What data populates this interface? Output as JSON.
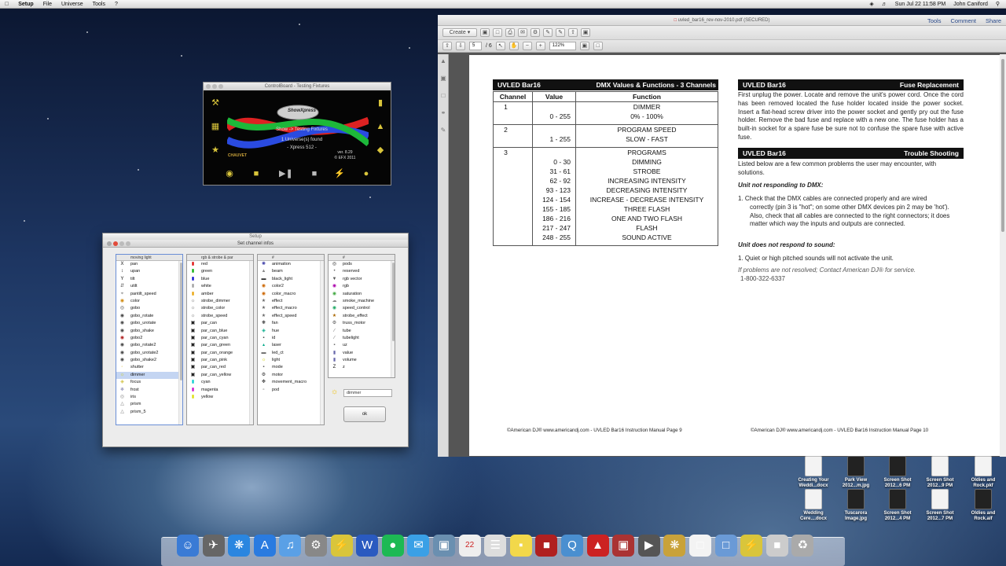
{
  "menubar": {
    "apple": "",
    "items": [
      "Setup",
      "File",
      "Universe",
      "Tools",
      "?"
    ],
    "clock": "Sun Jul 22  11:58 PM",
    "user": "John Caniford"
  },
  "controlboard": {
    "title": "ControlBoard - Testing Fixtures",
    "brand": "ShowXpress",
    "line1": "Show -> Testing Fixtures",
    "line2": "1 Universe(s) found",
    "line3": "- Xpress 512 -",
    "version": "ver. 8.29",
    "copyright": "© EFX 2011",
    "chauvet": "CHAUVET"
  },
  "setup": {
    "title": "Setup",
    "dialog_title": "Set channel infos",
    "col1_header": "moving light",
    "col2_header": "rgb & strobe & par",
    "col3_header": "#",
    "col4_header": "#",
    "col1": [
      "pan",
      "upan",
      "tilt",
      "utilt",
      "pantilt_speed",
      "color",
      "gobo",
      "gobo_rotate",
      "gobo_urotate",
      "gobo_shake",
      "gobo2",
      "gobo_rotate2",
      "gobo_urotate2",
      "gobo_shake2",
      "shutter",
      "dimmer",
      "focus",
      "frost",
      "iris",
      "prism",
      "prism_5"
    ],
    "col2": [
      "red",
      "green",
      "blue",
      "white",
      "amber",
      "strobe_dimmer",
      "strobe_color",
      "strobe_speed",
      "par_can",
      "par_can_blue",
      "par_can_cyan",
      "par_can_green",
      "par_can_orange",
      "par_can_pink",
      "par_can_red",
      "par_can_yellow",
      "cyan",
      "magenta",
      "yellow"
    ],
    "col3": [
      "animation",
      "beam",
      "black_light",
      "color2",
      "color_macro",
      "effect",
      "effect_macro",
      "effect_speed",
      "fan",
      "hue",
      "id",
      "laser",
      "led_ct",
      "light",
      "mode",
      "motor",
      "movement_macro",
      "pod"
    ],
    "col4": [
      "pods",
      "reserved",
      "rgb vector",
      "rgb",
      "saturation",
      "smoke_machine",
      "speed_control",
      "strobe_effect",
      "truss_motor",
      "tube",
      "tubelight",
      "uz",
      "value",
      "volume",
      "z"
    ],
    "selected": "dimmer",
    "field_value": "dimmer",
    "ok": "ok"
  },
  "pdf": {
    "title": "uvled_bar16_rev-nov-2010.pdf (SECURED)",
    "create": "Create",
    "page_current": "5",
    "page_total": "/ 6",
    "zoom": "122%",
    "links": [
      "Tools",
      "Comment",
      "Share"
    ],
    "left": {
      "bar_left": "UVLED Bar16",
      "bar_right": "DMX Values & Functions - 3 Channels",
      "th": [
        "Channel",
        "Value",
        "Function"
      ],
      "groups": [
        {
          "channel": "1",
          "values": [
            "",
            "0 - 255"
          ],
          "functions": [
            "DIMMER",
            "0% - 100%"
          ]
        },
        {
          "channel": "2",
          "values": [
            "",
            "1 - 255"
          ],
          "functions": [
            "PROGRAM SPEED",
            "SLOW - FAST"
          ]
        },
        {
          "channel": "3",
          "values": [
            "",
            "0 - 30",
            "31 - 61",
            "62 - 92",
            "93 - 123",
            "124 - 154",
            "155 - 185",
            "186 - 216",
            "217 - 247",
            "248 - 255"
          ],
          "functions": [
            "PROGRAMS",
            "DIMMING",
            "STROBE",
            "INCREASING INTENSITY",
            "DECREASING INTENSITY",
            "INCREASE - DECREASE INTENSITY",
            "THREE FLASH",
            "ONE AND TWO FLASH",
            "FLASH",
            "SOUND ACTIVE"
          ]
        }
      ],
      "footer": "©American DJ®   www.americandj.com  - UVLED Bar16 Instruction Manual Page 9"
    },
    "right": {
      "fuse_left": "UVLED Bar16",
      "fuse_right": "Fuse Replacement",
      "fuse_text": "First unplug the power. Locate and remove the unit's power cord. Once the cord has been removed located the fuse holder located inside the power socket. Insert a flat-head screw driver into the power socket and gently pry out the fuse holder. Remove the bad fuse and replace with a new one. The fuse holder has a built-in socket for a spare fuse be sure not to confuse the spare fuse with active fuse.",
      "ts_left": "UVLED Bar16",
      "ts_right": "Trouble Shooting",
      "ts_intro": "Listed below are a few common problems the user may encounter, with solutions.",
      "h1": "Unit not responding to DMX:",
      "item1": "1.    Check that the DMX cables are connected properly and are wired correctly (pin 3 is \"hot\"; on some other DMX devices pin 2 may be 'hot'). Also, check that all cables are connected to the right connectors; it does matter which way the inputs and outputs are connected.",
      "h2": "Unit does not respond to sound:",
      "item2": "1.    Quiet or high pitched sounds will not activate the unit.",
      "contact": "If problems are not resolved; Contact American DJ® for service.",
      "phone": "1-800-322-6337",
      "footer": "©American DJ®   www.americandj.com  - UVLED Bar16 Instruction Manual Page 10"
    }
  },
  "desktop_icons": [
    {
      "label": "Creating Your Weddi...docx",
      "kind": "doc"
    },
    {
      "label": "Park View 2012...m.jpg",
      "kind": "img"
    },
    {
      "label": "Screen Shot 2012...6 PM",
      "kind": "img"
    },
    {
      "label": "Screen Shot 2012...9 PM",
      "kind": "doc"
    },
    {
      "label": "Oldies and Rock.pkf",
      "kind": "pkf"
    },
    {
      "label": "Wedding Cere....docx",
      "kind": "doc"
    },
    {
      "label": "Tuscarora Image.jpg",
      "kind": "img"
    },
    {
      "label": "Screen Shot 2012...4 PM",
      "kind": "img"
    },
    {
      "label": "Screen Shot 2012...7 PM",
      "kind": "doc"
    },
    {
      "label": "Oldies and Rock.aif",
      "kind": "aif"
    }
  ],
  "dock": [
    "finder-icon",
    "launchpad-icon",
    "safari-icon",
    "app-store-icon",
    "itunes-icon",
    "system-preferences-icon",
    "showxpress-icon",
    "word-icon",
    "spotify-icon",
    "messages-icon",
    "preview-icon",
    "calendar-icon",
    "textedit-icon",
    "stickies-icon",
    "photo-booth-icon",
    "quicktime-icon",
    "acrobat-icon",
    "image-capture-icon",
    "movie-icon",
    "fixture-icon",
    "document-icon",
    "folder-icon",
    "showxpress-icon-2",
    "drive-icon",
    "trash-icon"
  ],
  "calendar_day": "22"
}
